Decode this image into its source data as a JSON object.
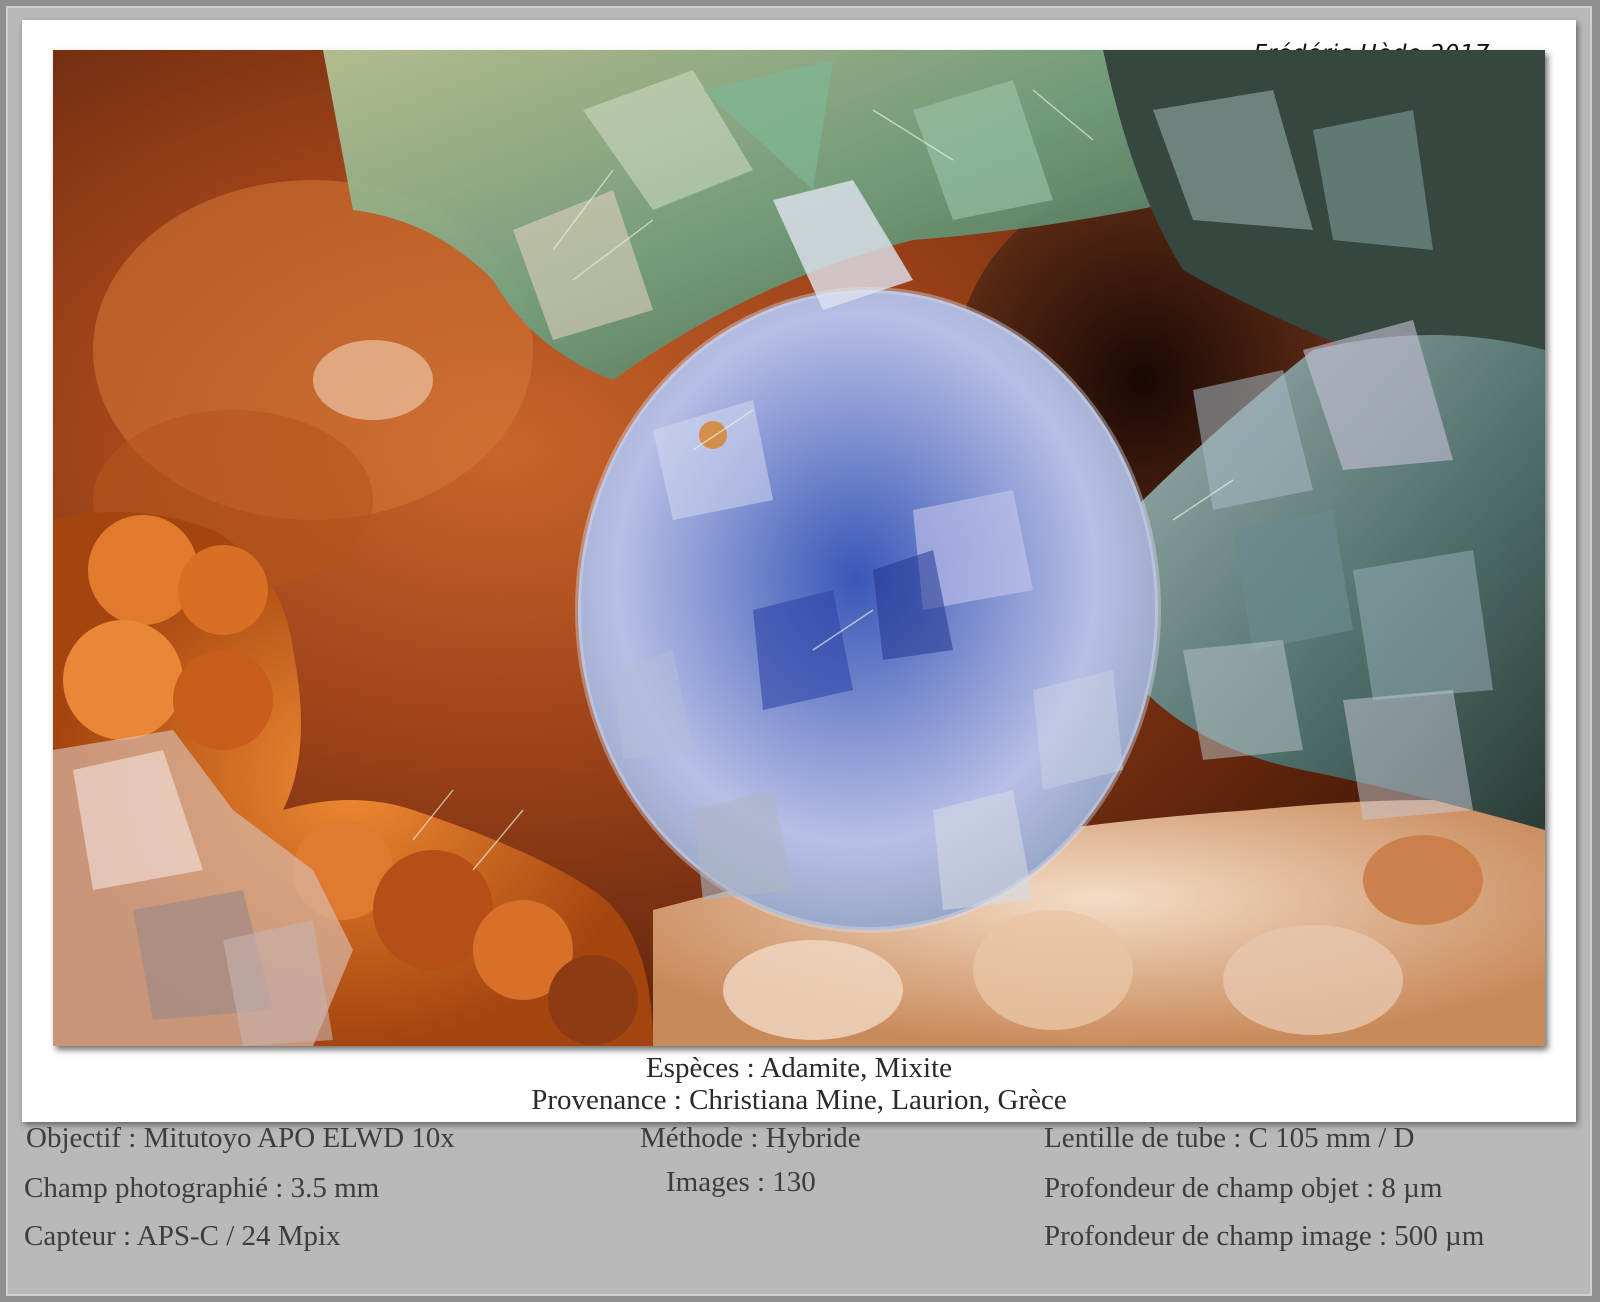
{
  "signature": "Frédéric Hède 2017",
  "photo": {
    "alt_icon": "mineral-photo-image"
  },
  "caption": {
    "species": "Espèces : Adamite, Mixite",
    "origin": "Provenance : Christiana Mine, Laurion, Grèce"
  },
  "technical": {
    "objective": "Objectif : Mitutoyo APO ELWD 10x",
    "field": "Champ photographié : 3.5 mm",
    "sensor": "Capteur : APS-C / 24 Mpix",
    "method": "Méthode : Hybride",
    "images": "Images : 130",
    "tube_lens": "Lentille de tube : C 105 mm / D",
    "dof_object": "Profondeur de champ objet : 8 µm",
    "dof_image": "Profondeur de champ image : 500 µm"
  },
  "colors": {
    "background": "#8f8f8f",
    "frame": "#b9b9b9",
    "card": "#ffffff",
    "caption_text": "#2a2a2a"
  }
}
